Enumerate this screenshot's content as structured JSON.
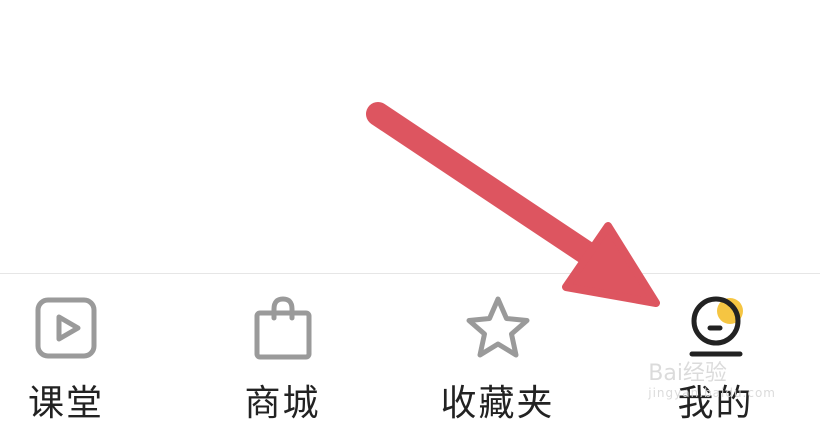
{
  "tabbar": {
    "items": [
      {
        "label": "课堂",
        "icon": "play-square-icon",
        "active": false
      },
      {
        "label": "商城",
        "icon": "shopping-bag-icon",
        "active": false
      },
      {
        "label": "收藏夹",
        "icon": "star-icon",
        "active": false
      },
      {
        "label": "我的",
        "icon": "profile-icon",
        "active": true
      }
    ]
  },
  "watermark": {
    "brand": "Bai经验",
    "url": "jingyan.baidu.com"
  },
  "colors": {
    "icon_inactive": "#9a9a9a",
    "icon_active": "#222222",
    "badge": "#f5c542",
    "arrow": "#dd5560"
  }
}
